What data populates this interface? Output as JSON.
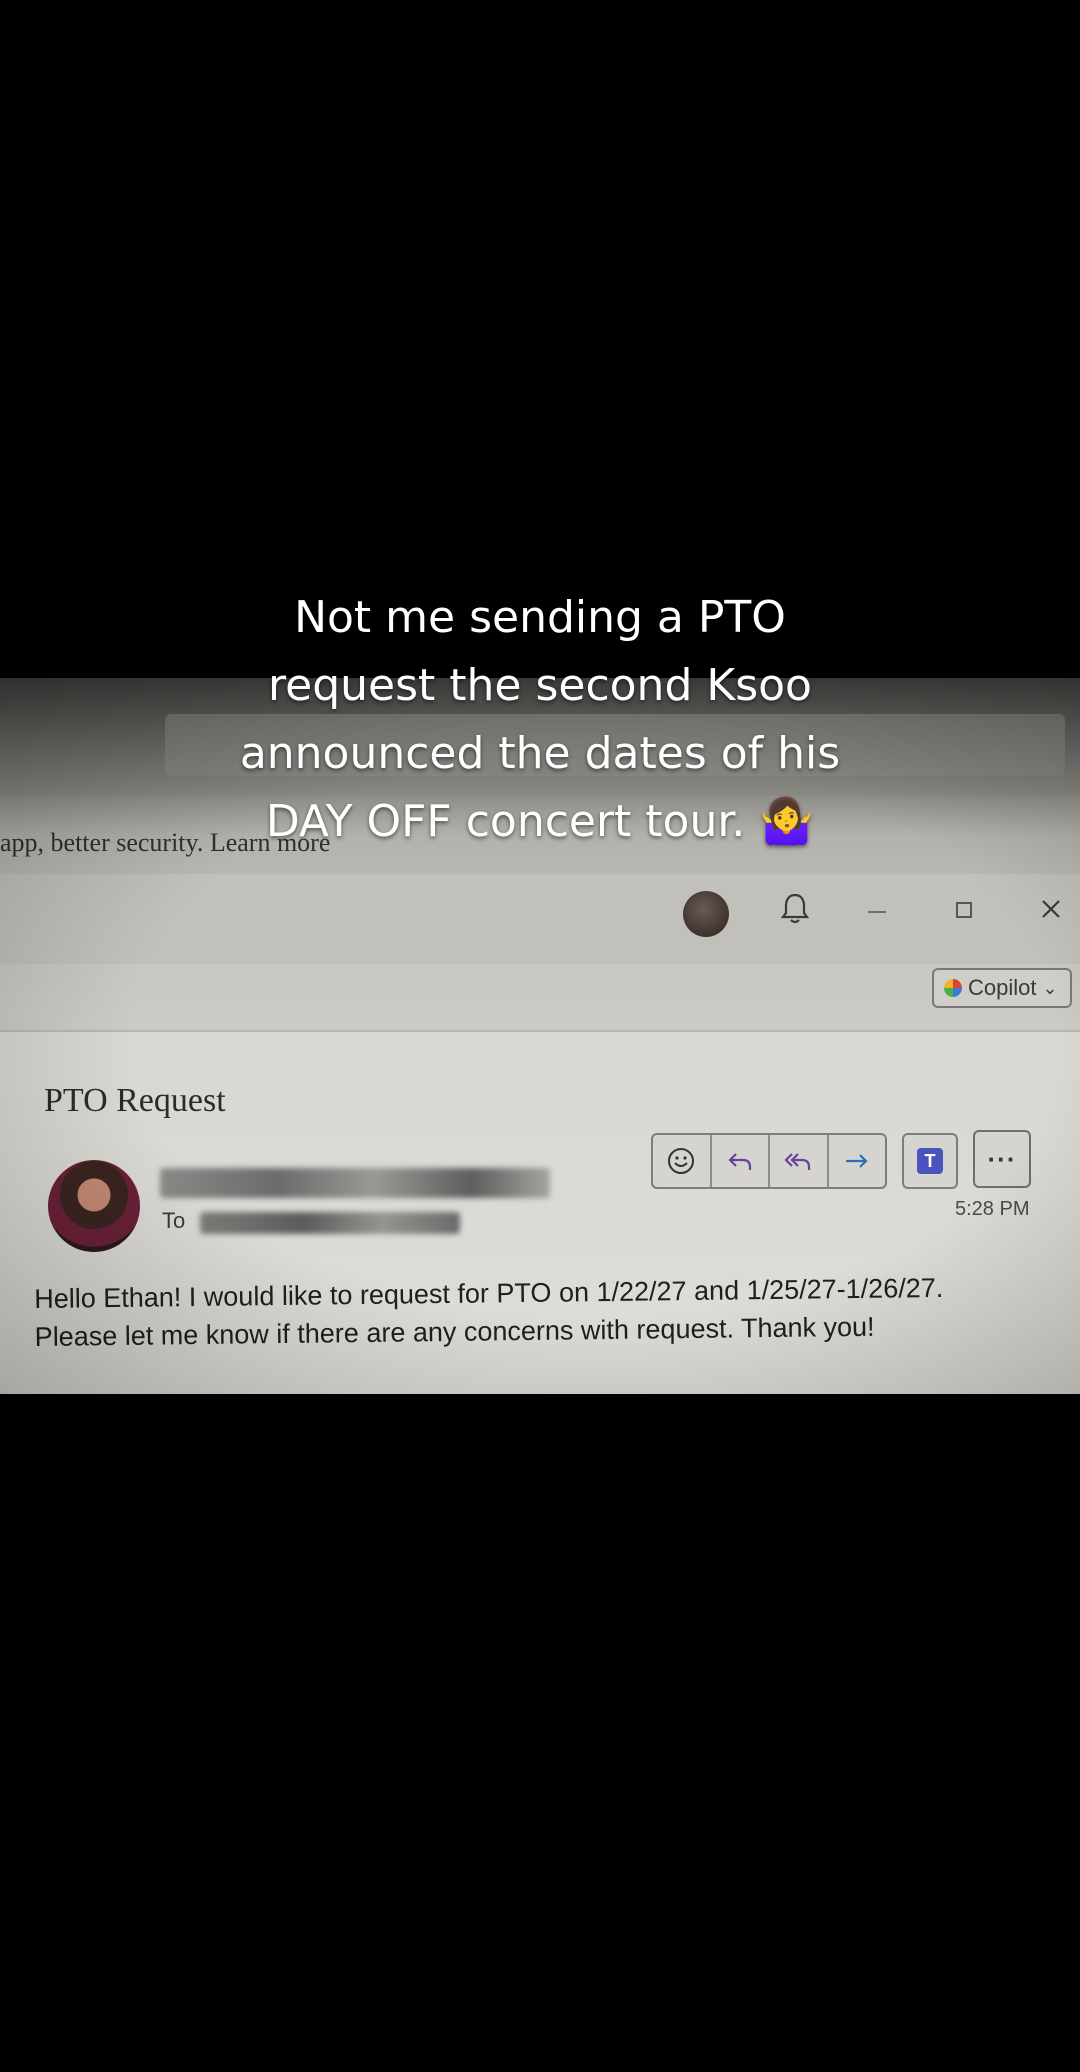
{
  "caption": {
    "line1": "Not me sending a PTO",
    "line2": "request the second Ksoo",
    "line3": "announced the dates of his",
    "line4": "DAY OFF concert tour.",
    "emoji": "🤷‍♀️"
  },
  "browser": {
    "banner_text": "app, better security. Learn more"
  },
  "window_controls": {
    "icons": [
      "profile-avatar",
      "bell-icon",
      "minimize-icon",
      "maximize-icon",
      "close-icon"
    ]
  },
  "toolbar": {
    "copilot_label": "Copilot",
    "copilot_chevron": "⌄",
    "actions": [
      "emoji-react-icon",
      "reply-icon",
      "reply-all-icon",
      "forward-icon"
    ],
    "more_label": "···"
  },
  "email": {
    "subject": "PTO Request",
    "to_label": "To",
    "time": "5:28 PM",
    "body_line1": "Hello Ethan! I would like to request for PTO on 1/22/27 and 1/25/27-1/26/27.",
    "body_line2": "Please let me know if there are any concerns with request. Thank you!"
  },
  "colors": {
    "background": "#000000",
    "caption_text": "#ffffff",
    "teams_purple": "#4b53bc"
  }
}
